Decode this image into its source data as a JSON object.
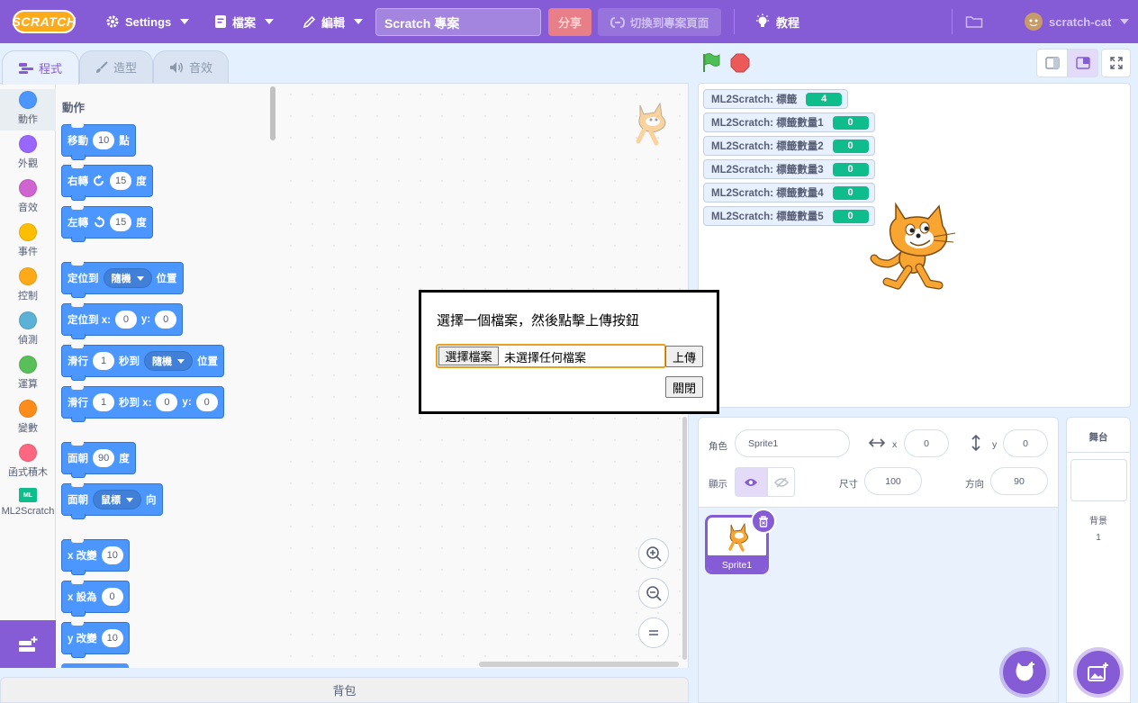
{
  "menubar": {
    "logo": "SCRATCH",
    "settings": "Settings",
    "file": "檔案",
    "edit": "編輯",
    "project_title": "Scratch 專案",
    "share": "分享",
    "see_project_page": "切換到專案頁面",
    "tutorials": "教程",
    "username": "scratch-cat"
  },
  "tabs": {
    "code": "程式",
    "costumes": "造型",
    "sounds": "音效"
  },
  "categories": [
    {
      "label": "動作",
      "color": "#4c97ff"
    },
    {
      "label": "外觀",
      "color": "#9966ff"
    },
    {
      "label": "音效",
      "color": "#cf63cf"
    },
    {
      "label": "事件",
      "color": "#ffbf00"
    },
    {
      "label": "控制",
      "color": "#ffab19"
    },
    {
      "label": "偵測",
      "color": "#5cb1d6"
    },
    {
      "label": "運算",
      "color": "#59c059"
    },
    {
      "label": "變數",
      "color": "#ff8c1a"
    },
    {
      "label": "函式積木",
      "color": "#ff6680"
    },
    {
      "label": "ML2Scratch",
      "color": "#0fbd8c"
    }
  ],
  "flyout": {
    "heading": "動作",
    "move": {
      "pre": "移動",
      "val": "10",
      "post": "點"
    },
    "turn_right": {
      "pre": "右轉",
      "val": "15",
      "post": "度"
    },
    "turn_left": {
      "pre": "左轉",
      "val": "15",
      "post": "度"
    },
    "goto": {
      "pre": "定位到",
      "dd": "隨機",
      "post": "位置"
    },
    "goto_xy": {
      "pre": "定位到 x:",
      "x": "0",
      "ylabel": "y:",
      "y": "0"
    },
    "glide": {
      "pre": "滑行",
      "val": "1",
      "mid": "秒到",
      "dd": "隨機",
      "post": "位置"
    },
    "glide_xy": {
      "pre": "滑行",
      "val": "1",
      "mid": "秒到 x:",
      "x": "0",
      "ylabel": "y:",
      "y": "0"
    },
    "point_dir": {
      "pre": "面朝",
      "val": "90",
      "post": "度"
    },
    "point_towards": {
      "pre": "面朝",
      "dd": "鼠標",
      "post": "向"
    },
    "change_x": {
      "pre": "x 改變",
      "val": "10"
    },
    "set_x": {
      "pre": "x 設為",
      "val": "0"
    },
    "change_y": {
      "pre": "y 改變",
      "val": "10"
    }
  },
  "backpack": "背包",
  "monitors": [
    {
      "label": "ML2Scratch: 標籤",
      "value": "4"
    },
    {
      "label": "ML2Scratch: 標籤數量1",
      "value": "0"
    },
    {
      "label": "ML2Scratch: 標籤數量2",
      "value": "0"
    },
    {
      "label": "ML2Scratch: 標籤數量3",
      "value": "0"
    },
    {
      "label": "ML2Scratch: 標籤數量4",
      "value": "0"
    },
    {
      "label": "ML2Scratch: 標籤數量5",
      "value": "0"
    }
  ],
  "dialog": {
    "message": "選擇一個檔案，然後點擊上傳按鈕",
    "choose_file": "選擇檔案",
    "no_file": "未選擇任何檔案",
    "upload": "上傳",
    "close": "關閉"
  },
  "sprite_info": {
    "sprite_label": "角色",
    "sprite_name": "Sprite1",
    "x_label": "x",
    "x": "0",
    "y_label": "y",
    "y": "0",
    "show_label": "顯示",
    "size_label": "尺寸",
    "size": "100",
    "direction_label": "方向",
    "direction": "90"
  },
  "sprites": [
    {
      "name": "Sprite1"
    }
  ],
  "stage_panel": {
    "title": "舞台",
    "backdrops_label": "背景",
    "backdrops_count": "1"
  },
  "colors": {
    "accent": "#855cd6",
    "motion": "#4c97ff",
    "ml2scratch": "#0fbd8c"
  }
}
